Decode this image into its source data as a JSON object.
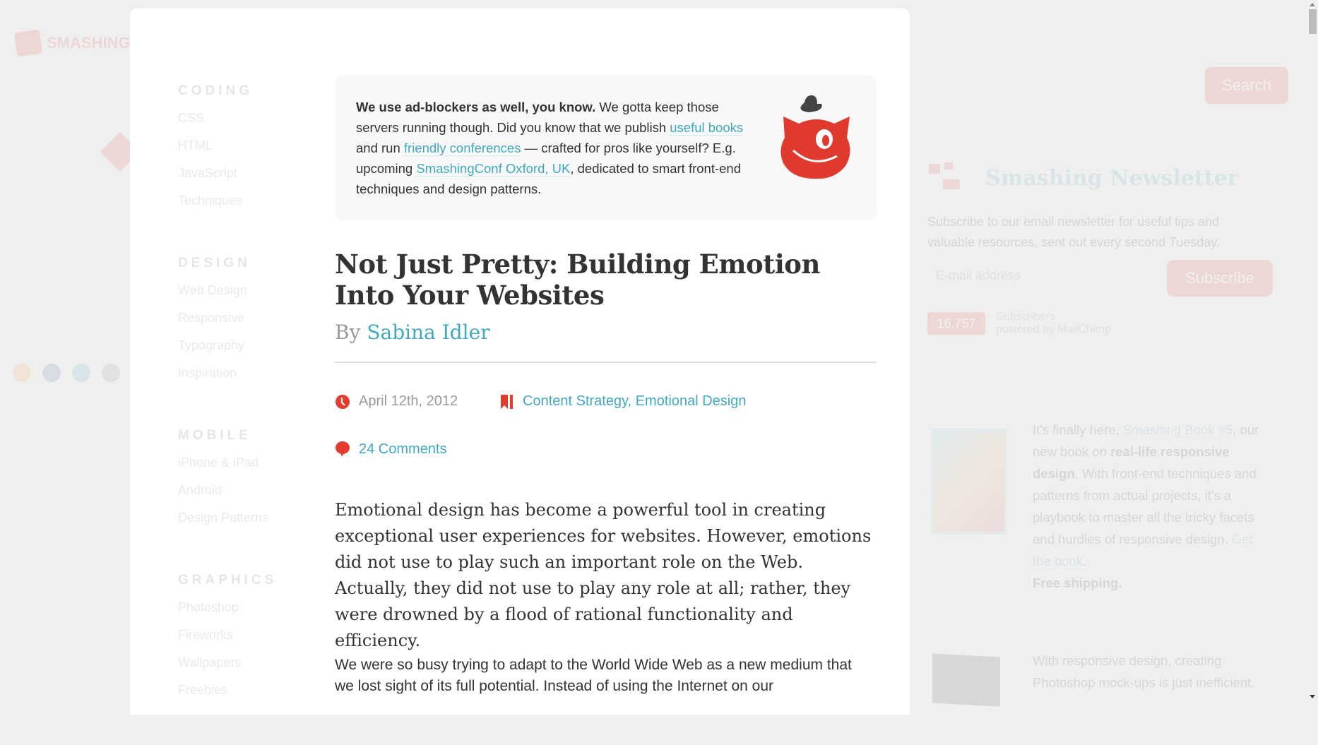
{
  "brand": {
    "logo_text": "SMASHING",
    "accent": "#e53b2c",
    "link_color": "#3fa9c0"
  },
  "category_nav": [
    {
      "heading": "CODING",
      "items": [
        "CSS",
        "HTML",
        "JavaScript",
        "Techniques"
      ]
    },
    {
      "heading": "DESIGN",
      "items": [
        "Web Design",
        "Responsive",
        "Typography",
        "Inspiration"
      ]
    },
    {
      "heading": "MOBILE",
      "items": [
        "iPhone & iPad",
        "Android",
        "Design Patterns"
      ]
    },
    {
      "heading": "GRAPHICS",
      "items": [
        "Photoshop",
        "Fireworks",
        "Wallpapers",
        "Freebies"
      ]
    }
  ],
  "ad_notice": {
    "bold": "We use ad-blockers as well, you know.",
    "t1": " We gotta keep those servers running though. Did you know that we publish ",
    "link1": "useful books",
    "t2": " and run ",
    "link2": "friendly conferences",
    "t3": " — crafted for pros like yourself? E.g. upcoming ",
    "link3": "SmashingConf Oxford, UK",
    "t4": ", dedicated to smart front-end techniques and design patterns.",
    "mascot_icon": "smashing-cat-mascot"
  },
  "article": {
    "title": "Not Just Pretty: Building Emotion Into Your Websites",
    "by": "By",
    "author": "Sabina Idler",
    "date": "April 12th, 2012",
    "categories": "Content Strategy, Emotional Design",
    "comments": "24 Comments",
    "lead": "Emotional design has become a powerful tool in creating exceptional user experiences for websites. However, emotions did not use to play such an important role on the Web. Actually, they did not use to play any role at all; rather, they were drowned by a flood of rational functionality and efficiency.",
    "para2": "We were so busy trying to adapt to the World Wide Web as a new medium that we lost sight of its full potential. Instead of using the Internet on our"
  },
  "sidebar": {
    "search_button": "Search",
    "newsletter_title": "Smashing Newsletter",
    "newsletter_desc": "Subscribe to our email newsletter for useful tips and valuable resources, sent out every second Tuesday.",
    "email_placeholder": "E-mail address",
    "subscribe_button": "Subscribe",
    "subscriber_count": "16,757",
    "subscribers_label": "Subscribers",
    "powered_by": "powered by MailChimp",
    "book1": {
      "t1": "It's finally here, ",
      "link": "Smashing Book #5",
      "t2": ", our new book on ",
      "bold": "real-life responsive design",
      "t3": ". With front-end techniques and patterns from actual projects, it's a playbook to master all the tricky facets and hurdles of responsive design. ",
      "cta": "Get the book",
      "shipping": "Free shipping."
    },
    "book2_text": "With responsive design, creating Photoshop mock-ups is just inefficient."
  }
}
